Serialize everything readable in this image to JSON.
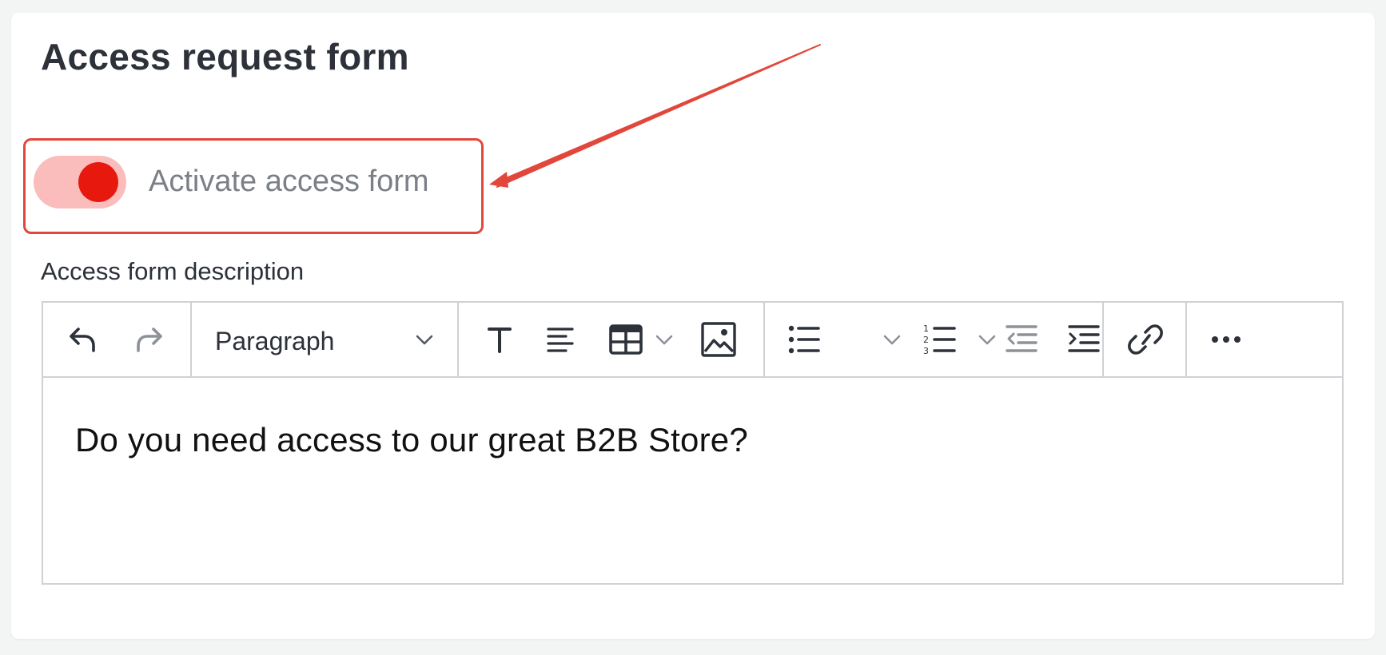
{
  "form": {
    "title": "Access request form",
    "toggle": {
      "label": "Activate access form",
      "state": "on",
      "accent_color": "#e7190f"
    },
    "description_label": "Access form description"
  },
  "editor": {
    "toolbar": {
      "block_format": "Paragraph",
      "buttons": [
        "undo-icon",
        "redo-icon",
        "text-format-icon",
        "align-left-icon",
        "table-icon",
        "image-icon",
        "bullet-list-icon",
        "numbered-list-icon",
        "outdent-icon",
        "indent-icon",
        "link-icon",
        "more-icon"
      ]
    },
    "content": "Do you need access to our great B2B Store?"
  },
  "annotation": {
    "color": "#e2473b"
  }
}
